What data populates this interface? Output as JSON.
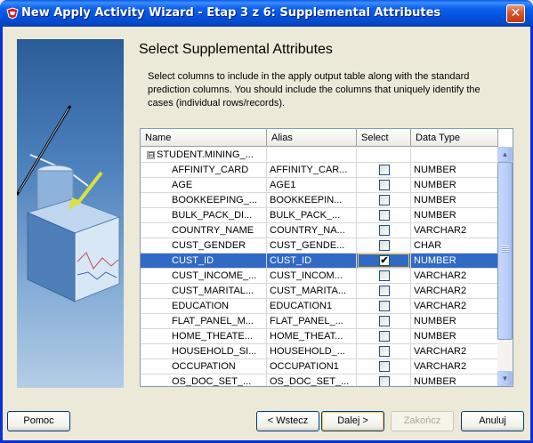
{
  "window": {
    "title": "New Apply Activity Wizard - Etap 3 z 6: Supplemental Attributes",
    "close_label": "✕"
  },
  "page": {
    "heading": "Select Supplemental Attributes",
    "description": "Select columns to include in the apply output table along with the standard prediction columns. You should include the columns that uniquely identify the cases (individual rows/records)."
  },
  "table": {
    "headers": {
      "name": "Name",
      "alias": "Alias",
      "select": "Select",
      "data_type": "Data Type"
    },
    "root": {
      "toggle": "⊟",
      "name": "STUDENT.MINING_..."
    },
    "rows": [
      {
        "name": "AFFINITY_CARD",
        "alias": "AFFINITY_CAR...",
        "checked": false,
        "type": "NUMBER"
      },
      {
        "name": "AGE",
        "alias": "AGE1",
        "checked": false,
        "type": "NUMBER"
      },
      {
        "name": "BOOKKEEPING_...",
        "alias": "BOOKKEEPIN...",
        "checked": false,
        "type": "NUMBER"
      },
      {
        "name": "BULK_PACK_DI...",
        "alias": "BULK_PACK_...",
        "checked": false,
        "type": "NUMBER"
      },
      {
        "name": "COUNTRY_NAME",
        "alias": "COUNTRY_NA...",
        "checked": false,
        "type": "VARCHAR2"
      },
      {
        "name": "CUST_GENDER",
        "alias": "CUST_GENDE...",
        "checked": false,
        "type": "CHAR"
      },
      {
        "name": "CUST_ID",
        "alias": "CUST_ID",
        "checked": true,
        "type": "NUMBER",
        "selected": true
      },
      {
        "name": "CUST_INCOME_...",
        "alias": "CUST_INCOM...",
        "checked": false,
        "type": "VARCHAR2"
      },
      {
        "name": "CUST_MARITAL...",
        "alias": "CUST_MARITA...",
        "checked": false,
        "type": "VARCHAR2"
      },
      {
        "name": "EDUCATION",
        "alias": "EDUCATION1",
        "checked": false,
        "type": "VARCHAR2"
      },
      {
        "name": "FLAT_PANEL_M...",
        "alias": "FLAT_PANEL_...",
        "checked": false,
        "type": "NUMBER"
      },
      {
        "name": "HOME_THEATE...",
        "alias": "HOME_THEAT...",
        "checked": false,
        "type": "NUMBER"
      },
      {
        "name": "HOUSEHOLD_SI...",
        "alias": "HOUSEHOLD_...",
        "checked": false,
        "type": "VARCHAR2"
      },
      {
        "name": "OCCUPATION",
        "alias": "OCCUPATION1",
        "checked": false,
        "type": "VARCHAR2"
      },
      {
        "name": "OS_DOC_SET_...",
        "alias": "OS_DOC_SET_...",
        "checked": false,
        "type": "NUMBER"
      }
    ],
    "scroll_up": "▲",
    "scroll_down": "▼"
  },
  "buttons": {
    "help": "Pomoc",
    "back": "< Wstecz",
    "next": "Dalej >",
    "finish": "Zakończ",
    "cancel": "Anuluj"
  },
  "icons": {
    "app": "oracle-wizard-icon",
    "banner": "database-funnel-illustration"
  }
}
